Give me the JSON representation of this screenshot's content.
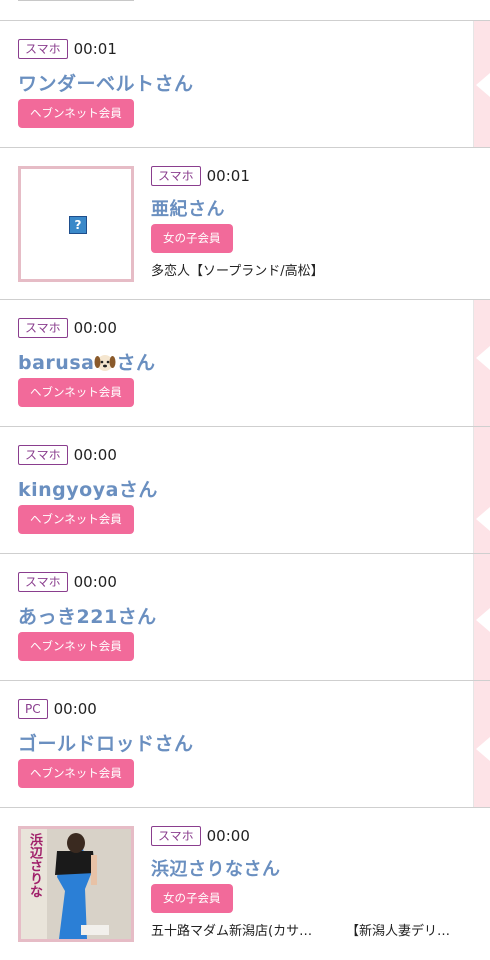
{
  "entries": [
    {
      "device": "スマホ",
      "time": "00:01",
      "name": "ワンダーベルトさん",
      "badge": "ヘブンネット会員"
    },
    {
      "device": "スマホ",
      "time": "00:01",
      "name": "亜紀さん",
      "badge": "女の子会員",
      "shop": "多恋人【ソープランド/高松】",
      "thumb_icon": "broken-image-icon"
    },
    {
      "device": "スマホ",
      "time": "00:00",
      "name_prefix": "barusa",
      "name_suffix": "さん",
      "name_emoji": "dog-face-emoji",
      "badge": "ヘブンネット会員"
    },
    {
      "device": "スマホ",
      "time": "00:00",
      "name": "kingyoyaさん",
      "badge": "ヘブンネット会員"
    },
    {
      "device": "スマホ",
      "time": "00:00",
      "name": "あっき221さん",
      "badge": "ヘブンネット会員"
    },
    {
      "device": "PC",
      "time": "00:00",
      "name": "ゴールドロッドさん",
      "badge": "ヘブンネット会員"
    },
    {
      "device": "スマホ",
      "time": "00:00",
      "name": "浜辺さりなさん",
      "badge": "女の子会員",
      "shop_left": "五十路マダム新潟店(カサ…",
      "shop_right": "【新潟人妻デリ…",
      "thumb_caption": "浜辺さりな"
    }
  ],
  "colors": {
    "name": "#6a8fc0",
    "device_border": "#8a3e8e",
    "badge": "#f26a9a",
    "edge": "#fde3e7",
    "thumb_border": "#e6bcc6"
  }
}
